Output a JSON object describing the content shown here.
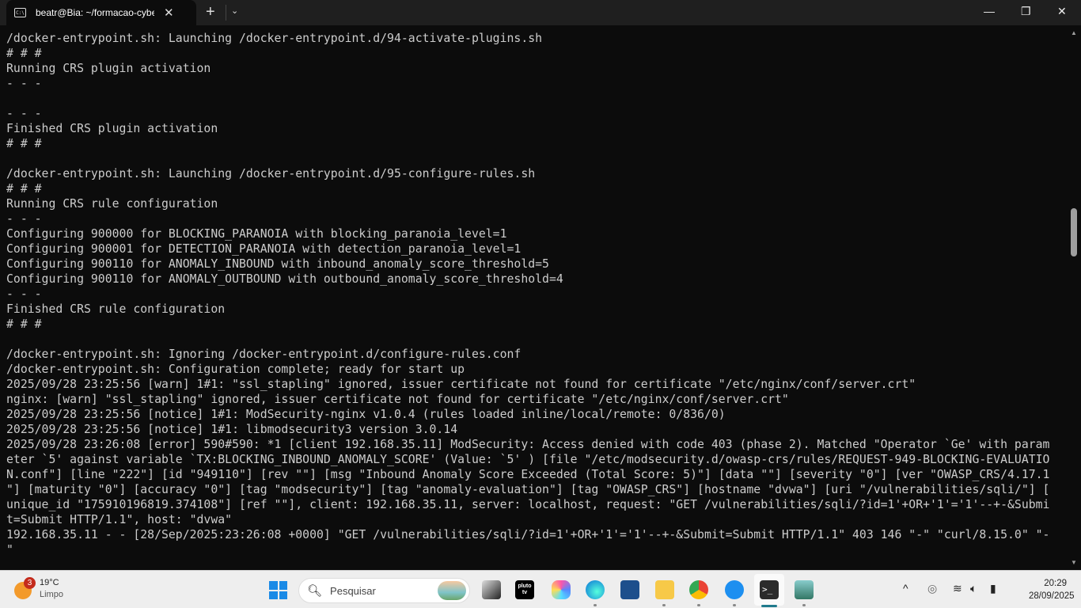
{
  "window": {
    "tab_title": "beatr@Bia: ~/formacao-cyber",
    "tab_icon": "terminal-prompt-icon",
    "tab_icon_text": "C:\\",
    "close_tab": "✕",
    "new_tab": "+",
    "dropdown": "⌄",
    "minimize": "—",
    "maximize": "❐",
    "close": "✕"
  },
  "terminal": {
    "colors": {
      "background": "#0c0c0c",
      "text": "#cccccc"
    },
    "lines": [
      "/docker-entrypoint.sh: Launching /docker-entrypoint.d/94-activate-plugins.sh",
      "# # #",
      "Running CRS plugin activation",
      "- - -",
      "",
      "- - -",
      "Finished CRS plugin activation",
      "# # #",
      "",
      "/docker-entrypoint.sh: Launching /docker-entrypoint.d/95-configure-rules.sh",
      "# # #",
      "Running CRS rule configuration",
      "- - -",
      "Configuring 900000 for BLOCKING_PARANOIA with blocking_paranoia_level=1",
      "Configuring 900001 for DETECTION_PARANOIA with detection_paranoia_level=1",
      "Configuring 900110 for ANOMALY_INBOUND with inbound_anomaly_score_threshold=5",
      "Configuring 900110 for ANOMALY_OUTBOUND with outbound_anomaly_score_threshold=4",
      "- - -",
      "Finished CRS rule configuration",
      "# # #",
      "",
      "/docker-entrypoint.sh: Ignoring /docker-entrypoint.d/configure-rules.conf",
      "/docker-entrypoint.sh: Configuration complete; ready for start up",
      "2025/09/28 23:25:56 [warn] 1#1: \"ssl_stapling\" ignored, issuer certificate not found for certificate \"/etc/nginx/conf/server.crt\"",
      "nginx: [warn] \"ssl_stapling\" ignored, issuer certificate not found for certificate \"/etc/nginx/conf/server.crt\"",
      "2025/09/28 23:25:56 [notice] 1#1: ModSecurity-nginx v1.0.4 (rules loaded inline/local/remote: 0/836/0)",
      "2025/09/28 23:25:56 [notice] 1#1: libmodsecurity3 version 3.0.14",
      "2025/09/28 23:26:08 [error] 590#590: *1 [client 192.168.35.11] ModSecurity: Access denied with code 403 (phase 2). Matched \"Operator `Ge' with param",
      "eter `5' against variable `TX:BLOCKING_INBOUND_ANOMALY_SCORE' (Value: `5' ) [file \"/etc/modsecurity.d/owasp-crs/rules/REQUEST-949-BLOCKING-EVALUATIO",
      "N.conf\"] [line \"222\"] [id \"949110\"] [rev \"\"] [msg \"Inbound Anomaly Score Exceeded (Total Score: 5)\"] [data \"\"] [severity \"0\"] [ver \"OWASP_CRS/4.17.1",
      "\"] [maturity \"0\"] [accuracy \"0\"] [tag \"modsecurity\"] [tag \"anomaly-evaluation\"] [tag \"OWASP_CRS\"] [hostname \"dvwa\"] [uri \"/vulnerabilities/sqli/\"] [",
      "unique_id \"175910196819.374108\"] [ref \"\"], client: 192.168.35.11, server: localhost, request: \"GET /vulnerabilities/sqli/?id=1'+OR+'1'='1'--+-&Submi",
      "t=Submit HTTP/1.1\", host: \"dvwa\"",
      "192.168.35.11 - - [28/Sep/2025:23:26:08 +0000] \"GET /vulnerabilities/sqli/?id=1'+OR+'1'='1'--+-&Submit=Submit HTTP/1.1\" 403 146 \"-\" \"curl/8.15.0\" \"-",
      "\""
    ]
  },
  "taskbar": {
    "weather": {
      "badge": "3",
      "temp": "19°C",
      "condition": "Limpo"
    },
    "search_placeholder": "Pesquisar",
    "apps": [
      "task-view",
      "pluto-tv",
      "copilot",
      "edge",
      "microsoft-store",
      "file-explorer",
      "chrome",
      "docker-desktop",
      "terminal",
      "photos"
    ],
    "pluto_label": "pluto tv",
    "tray": {
      "chevron": "^",
      "wifi": "wifi-icon",
      "volume": "volume-icon",
      "battery": "battery-icon"
    },
    "clock": {
      "time": "20:29",
      "date": "28/09/2025"
    }
  }
}
